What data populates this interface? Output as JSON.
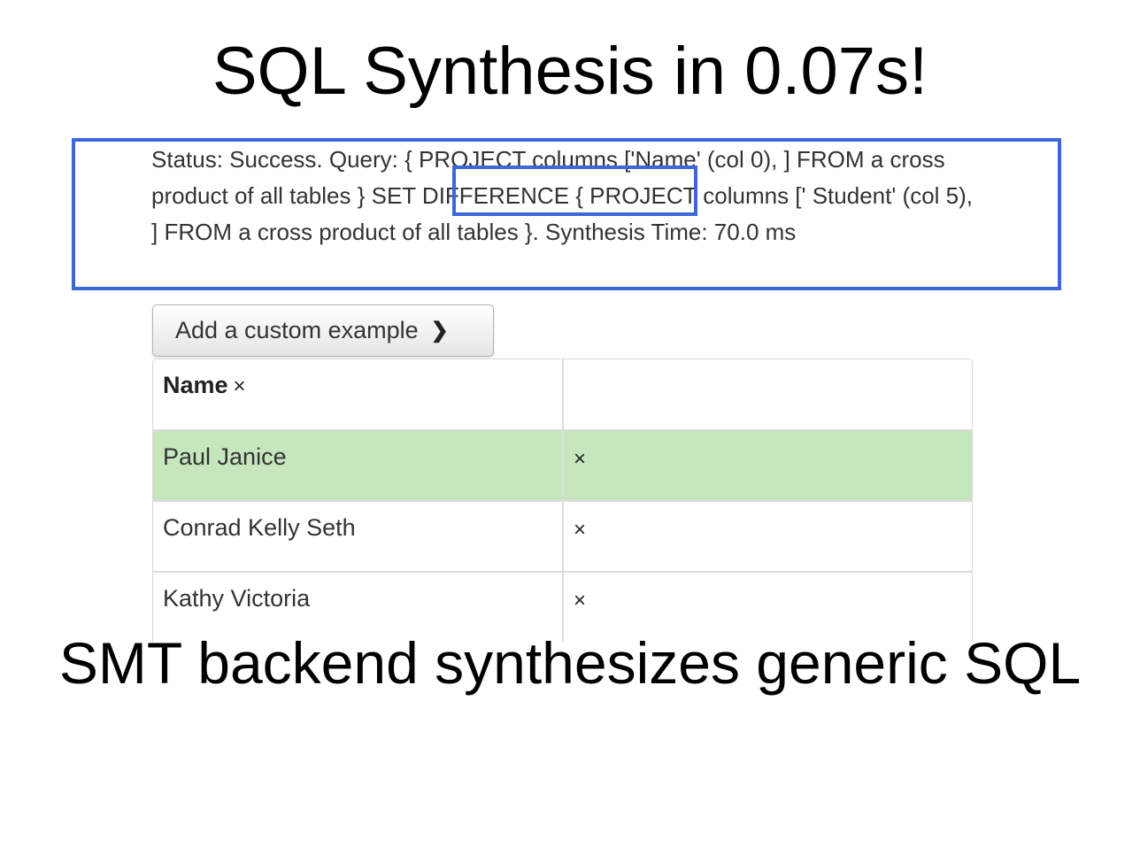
{
  "slide": {
    "title": "SQL Synthesis in 0.07s!",
    "footer": "SMT backend synthesizes generic SQL"
  },
  "status": {
    "text": "Status: Success. Query: { PROJECT columns ['Name' (col 0), ] FROM a cross product of all tables } SET DIFFERENCE { PROJECT columns [' Student' (col 5), ] FROM a cross product of all tables }. Synthesis Time: 70.0 ms",
    "highlighted_phrase": "SET DIFFERENCE"
  },
  "add_button": {
    "label": "Add a custom example",
    "icon": "chevron-right-icon"
  },
  "table": {
    "columns": [
      {
        "label": "Name",
        "remove": "×"
      },
      {
        "label": ""
      }
    ],
    "rows": [
      {
        "name": "Paul Janice",
        "remove": "×",
        "highlighted": true
      },
      {
        "name": "Conrad Kelly Seth",
        "remove": "×",
        "highlighted": false
      },
      {
        "name": "Kathy Victoria",
        "remove": "×",
        "highlighted": false
      }
    ]
  },
  "colors": {
    "accent_box": "#3d66d9",
    "highlight_row": "#c6e6bd"
  }
}
